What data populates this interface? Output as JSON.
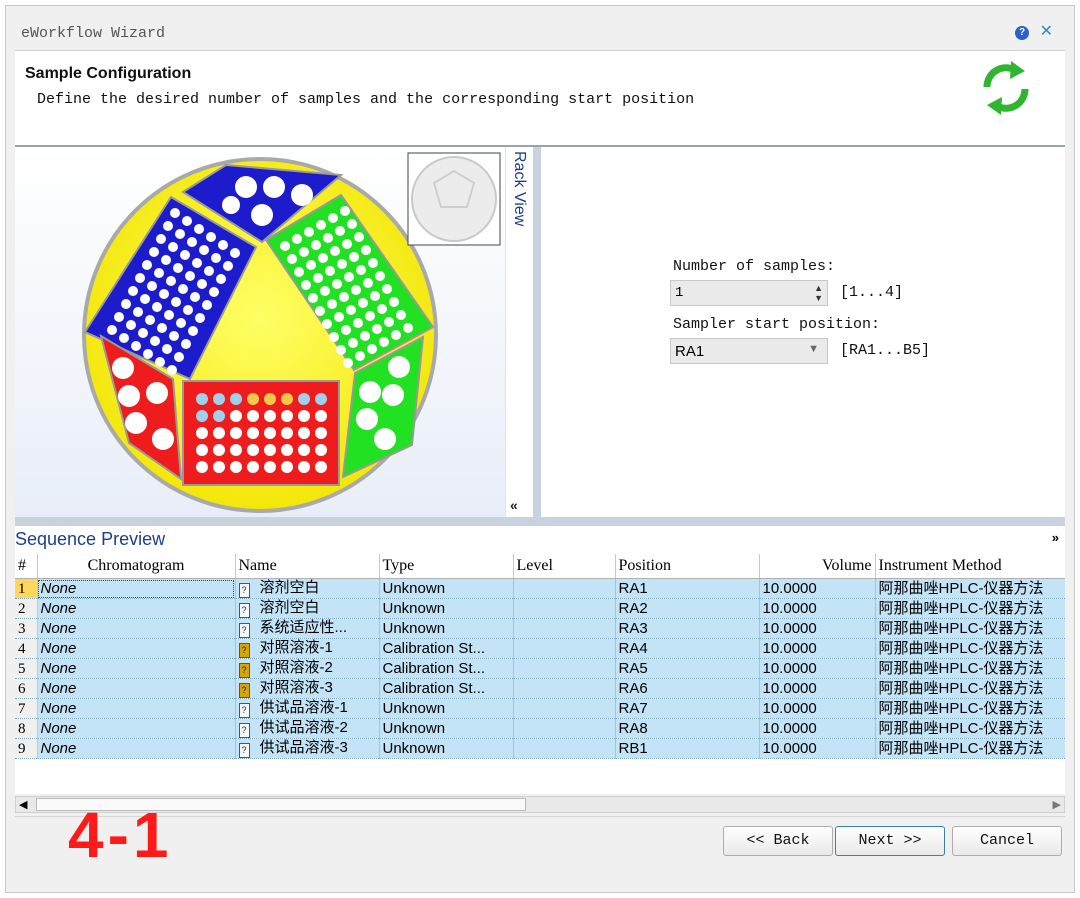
{
  "window": {
    "title": "eWorkflow Wizard"
  },
  "header": {
    "title": "Sample Configuration",
    "subtitle": "Define the desired number of samples and the corresponding start position"
  },
  "rack": {
    "side_label": "Rack View",
    "collapse_glyph": "«"
  },
  "settings": {
    "samples_label": "Number of samples:",
    "samples_value": "1",
    "samples_range": "[1...4]",
    "start_label": "Sampler start position:",
    "start_value": "RA1",
    "start_range": "[RA1...B5]"
  },
  "sequence": {
    "title": "Sequence Preview",
    "expand_glyph": "»",
    "columns": [
      "#",
      "Chromatogram",
      "Name",
      "Type",
      "Level",
      "Position",
      "Volume",
      "Instrument Method"
    ],
    "rows": [
      {
        "n": "1",
        "chrom": "None",
        "name": "溶剂空白",
        "type": "Unknown",
        "level": "",
        "pos": "RA1",
        "vol": "10.0000",
        "method": "阿那曲唑HPLC-仪器方法"
      },
      {
        "n": "2",
        "chrom": "None",
        "name": "溶剂空白",
        "type": "Unknown",
        "level": "",
        "pos": "RA2",
        "vol": "10.0000",
        "method": "阿那曲唑HPLC-仪器方法"
      },
      {
        "n": "3",
        "chrom": "None",
        "name": "系统适应性...",
        "type": "Unknown",
        "level": "",
        "pos": "RA3",
        "vol": "10.0000",
        "method": "阿那曲唑HPLC-仪器方法"
      },
      {
        "n": "4",
        "chrom": "None",
        "name": "对照溶液-1",
        "type": "Calibration St...",
        "level": "",
        "pos": "RA4",
        "vol": "10.0000",
        "method": "阿那曲唑HPLC-仪器方法"
      },
      {
        "n": "5",
        "chrom": "None",
        "name": "对照溶液-2",
        "type": "Calibration St...",
        "level": "",
        "pos": "RA5",
        "vol": "10.0000",
        "method": "阿那曲唑HPLC-仪器方法"
      },
      {
        "n": "6",
        "chrom": "None",
        "name": "对照溶液-3",
        "type": "Calibration St...",
        "level": "",
        "pos": "RA6",
        "vol": "10.0000",
        "method": "阿那曲唑HPLC-仪器方法"
      },
      {
        "n": "7",
        "chrom": "None",
        "name": "供试品溶液-1",
        "type": "Unknown",
        "level": "",
        "pos": "RA7",
        "vol": "10.0000",
        "method": "阿那曲唑HPLC-仪器方法"
      },
      {
        "n": "8",
        "chrom": "None",
        "name": "供试品溶液-2",
        "type": "Unknown",
        "level": "",
        "pos": "RA8",
        "vol": "10.0000",
        "method": "阿那曲唑HPLC-仪器方法"
      },
      {
        "n": "9",
        "chrom": "None",
        "name": "供试品溶液-3",
        "type": "Unknown",
        "level": "",
        "pos": "RB1",
        "vol": "10.0000",
        "method": "阿那曲唑HPLC-仪器方法"
      }
    ]
  },
  "footer": {
    "step_label": "4-1",
    "back_label": "<< Back",
    "next_label": "Next >>",
    "cancel_label": "Cancel"
  },
  "colors": {
    "accent": "#1b3f8b",
    "row_highlight": "#c3e3f7",
    "step_red": "#ff1a1a"
  }
}
